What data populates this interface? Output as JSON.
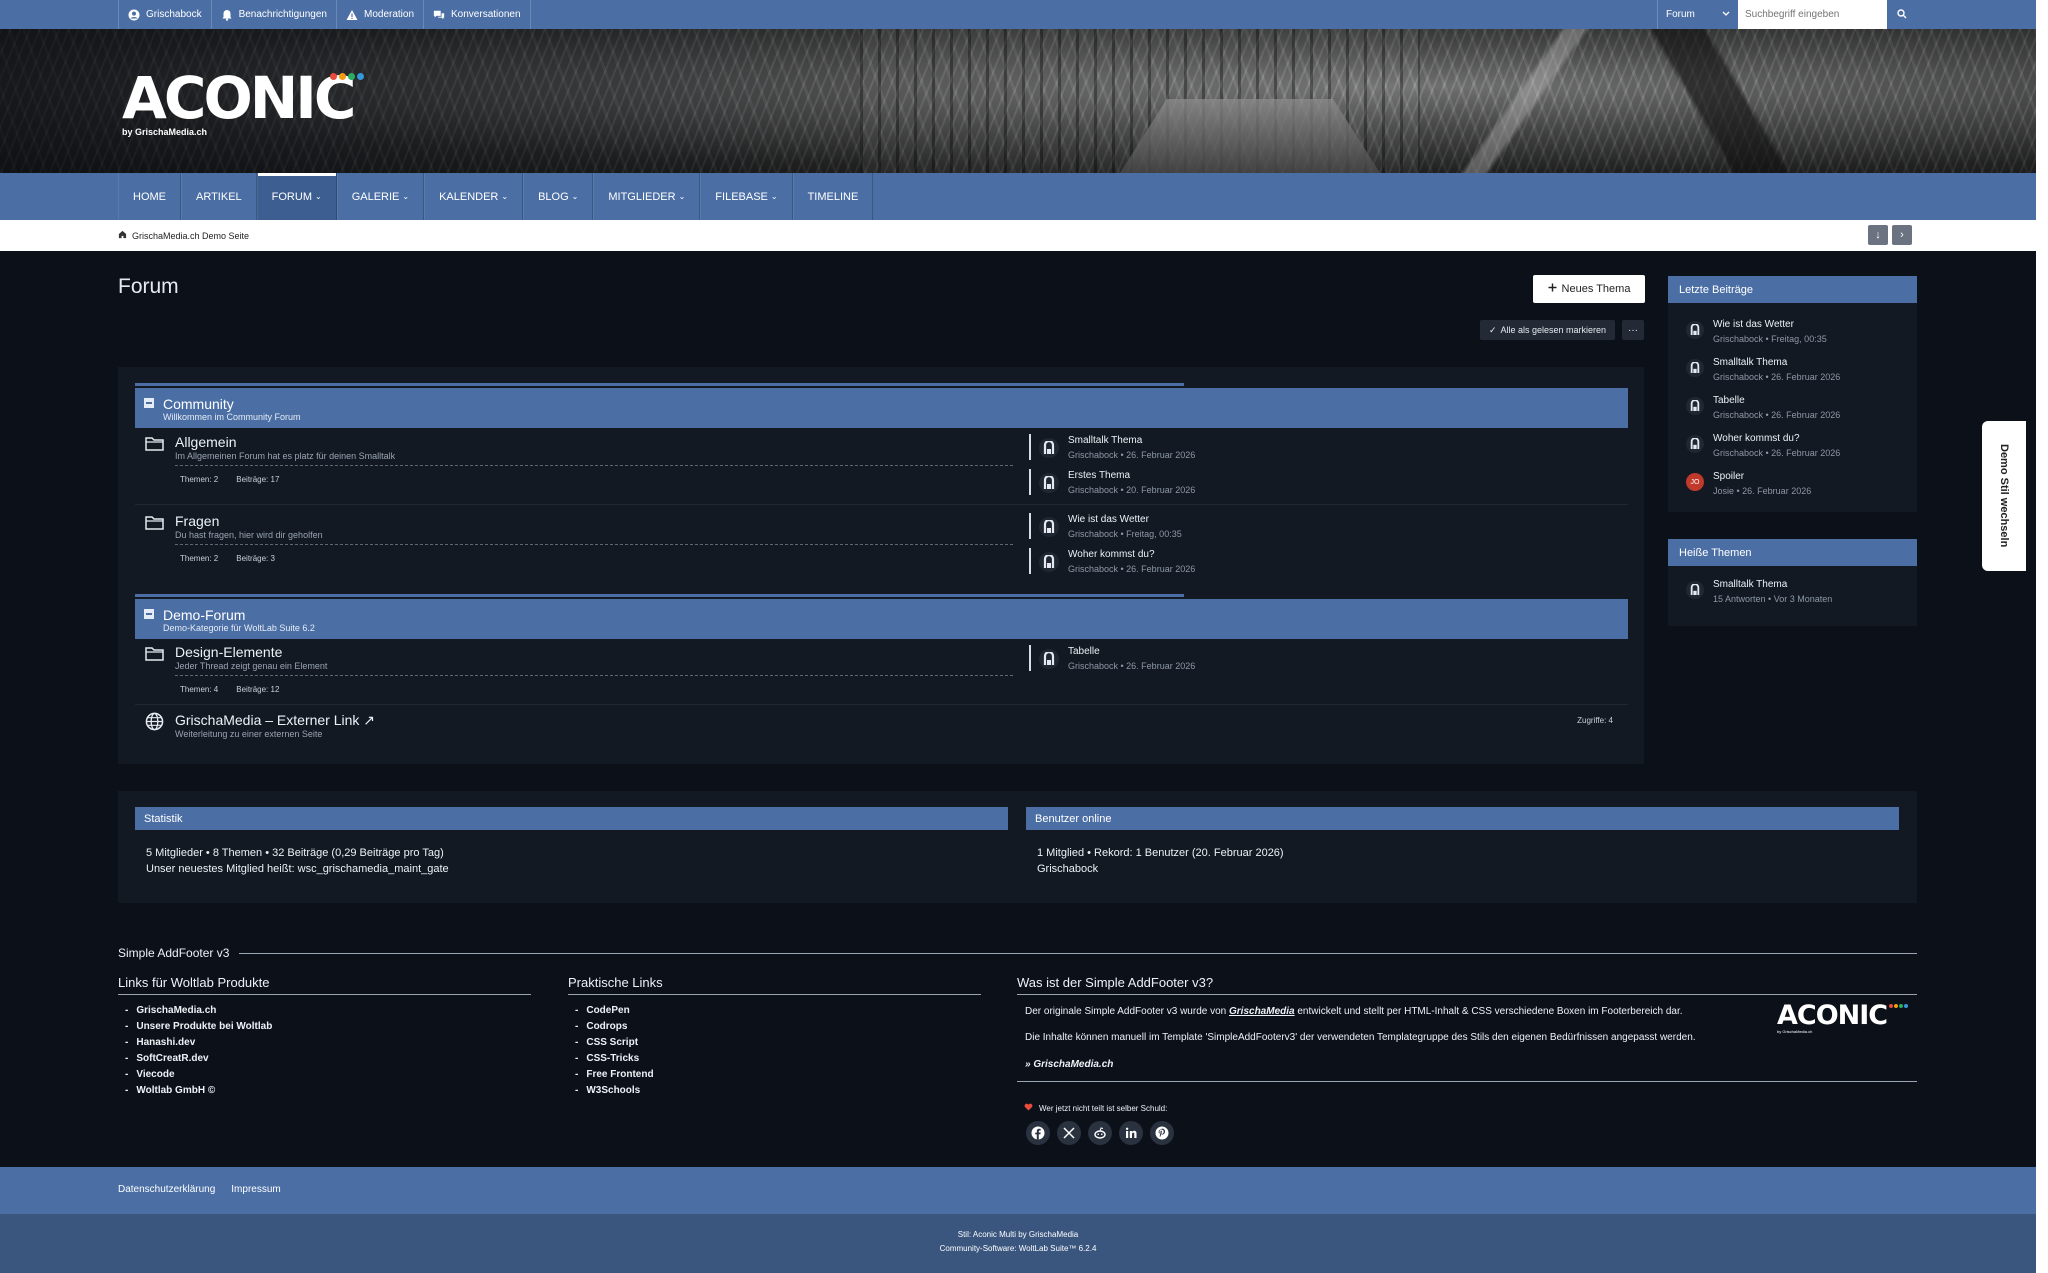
{
  "userbar": {
    "links": [
      {
        "label": "Grischabock",
        "icon": "user-icon"
      },
      {
        "label": "Benachrichtigungen",
        "icon": "bell-icon"
      },
      {
        "label": "Moderation",
        "icon": "warning-icon"
      },
      {
        "label": "Konversationen",
        "icon": "chat-icon"
      }
    ],
    "search_scope": "Forum",
    "search_placeholder": "Suchbegriff eingeben"
  },
  "header": {
    "logo_text": "ACONIC",
    "logo_sub": "by GrischaMedia.ch",
    "logo_dot_colors": [
      "#e74c3c",
      "#f39c12",
      "#27ae60",
      "#3498db"
    ]
  },
  "nav": {
    "items": [
      {
        "label": "HOME"
      },
      {
        "label": "ARTIKEL"
      },
      {
        "label": "FORUM",
        "dropdown": "⌄"
      },
      {
        "label": "GALERIE",
        "dropdown": "⌄"
      },
      {
        "label": "KALENDER",
        "dropdown": "⌄"
      },
      {
        "label": "BLOG",
        "dropdown": "⌄"
      },
      {
        "label": "MITGLIEDER",
        "dropdown": "⌄"
      },
      {
        "label": "FILEBASE",
        "dropdown": "⌄"
      },
      {
        "label": "TIMELINE"
      }
    ]
  },
  "breadcrumb": {
    "label": "GrischaMedia.ch Demo Seite"
  },
  "page": {
    "title": "Forum",
    "new_topic": "Neues Thema",
    "mark_read": "Alle als gelesen markieren",
    "more": "···"
  },
  "categories": [
    {
      "title": "Community",
      "desc": "Willkommen im Community Forum"
    },
    {
      "title": "Demo-Forum",
      "desc": "Demo-Kategorie für WoltLab Suite 6.2"
    }
  ],
  "boards": [
    {
      "name": "Allgemein",
      "desc": "Im Allgemeinen Forum hat es platz für deinen Smalltalk",
      "topics": "Themen: 2",
      "posts": "Beiträge: 17",
      "last": [
        {
          "title": "Smalltalk Thema",
          "meta": "Grischabock • 26. Februar 2026"
        },
        {
          "title": "Erstes Thema",
          "meta": "Grischabock • 20. Februar 2026"
        }
      ]
    },
    {
      "name": "Fragen",
      "desc": "Du hast fragen, hier wird dir geholfen",
      "topics": "Themen: 2",
      "posts": "Beiträge: 3",
      "last": [
        {
          "title": "Wie ist das Wetter",
          "meta": "Grischabock • Freitag, 00:35"
        },
        {
          "title": "Woher kommst du?",
          "meta": "Grischabock • 26. Februar 2026"
        }
      ]
    },
    {
      "name": "Design-Elemente",
      "desc": "Jeder Thread zeigt genau ein Element",
      "topics": "Themen: 4",
      "posts": "Beiträge: 12",
      "last": [
        {
          "title": "Tabelle",
          "meta": "Grischabock • 26. Februar 2026"
        }
      ]
    }
  ],
  "external": {
    "name": "GrischaMedia – Externer Link ↗",
    "desc": "Weiterleitung zu einer externen Seite",
    "hits": "Zugriffe: 4"
  },
  "sidebar": {
    "latest_title": "Letzte Beiträge",
    "latest": [
      {
        "title": "Wie ist das Wetter",
        "meta": "Grischabock • Freitag, 00:35"
      },
      {
        "title": "Smalltalk Thema",
        "meta": "Grischabock • 26. Februar 2026"
      },
      {
        "title": "Tabelle",
        "meta": "Grischabock • 26. Februar 2026"
      },
      {
        "title": "Woher kommst du?",
        "meta": "Grischabock • 26. Februar 2026"
      },
      {
        "title": "Spoiler",
        "meta": "Josie • 26. Februar 2026",
        "avatar_text": "JO"
      }
    ],
    "hot_title": "Heiße Themen",
    "hot": [
      {
        "title": "Smalltalk Thema",
        "meta": "15 Antworten • Vor 3 Monaten"
      }
    ]
  },
  "demo_tab": "Demo Stil wechseln",
  "stats": {
    "title": "Statistik",
    "line1": "5 Mitglieder • 8 Themen • 32 Beiträge (0,29 Beiträge pro Tag)",
    "line2": "Unser neuestes Mitglied heißt: wsc_grischamedia_maint_gate"
  },
  "online": {
    "title": "Benutzer online",
    "line1": "1 Mitglied • Rekord: 1 Benutzer (20. Februar 2026)",
    "line2": "Grischabock"
  },
  "addfooter": {
    "title": "Simple AddFooter v3",
    "col1_title": "Links für Woltlab Produkte",
    "col1": [
      "GrischaMedia.ch",
      "Unsere Produkte bei Woltlab",
      "Hanashi.dev",
      "SoftCreatR.dev",
      "Viecode",
      "Woltlab GmbH ©"
    ],
    "col2_title": "Praktische Links",
    "col2": [
      "CodePen",
      "Codrops",
      "CSS Script",
      "CSS-Tricks",
      "Free Frontend",
      "W3Schools"
    ],
    "col3_title": "Was ist der Simple AddFooter v3?",
    "p1_pre": "Der originale Simple AddFooter v3 wurde von ",
    "p1_link": "GrischaMedia",
    "p1_post": " entwickelt und stellt per HTML-Inhalt & CSS verschiedene Boxen im Footerbereich dar.",
    "p2": "Die Inhalte können manuell im Template 'SimpleAddFooterv3' der verwendeten Templategruppe des Stils den eigenen Bedürfnissen angepasst werden.",
    "p3": "» GrischaMedia.ch",
    "share": "Wer jetzt nicht teilt ist selber Schuld:",
    "socials": [
      "facebook-icon",
      "x-icon",
      "reddit-icon",
      "linkedin-icon",
      "pinterest-icon"
    ]
  },
  "footer": {
    "links": [
      "Datenschutzerklärung",
      "Impressum"
    ],
    "style": "Stil: Aconic Multi by GrischaMedia",
    "software": "Community-Software: WoltLab Suite™ 6.2.4"
  }
}
